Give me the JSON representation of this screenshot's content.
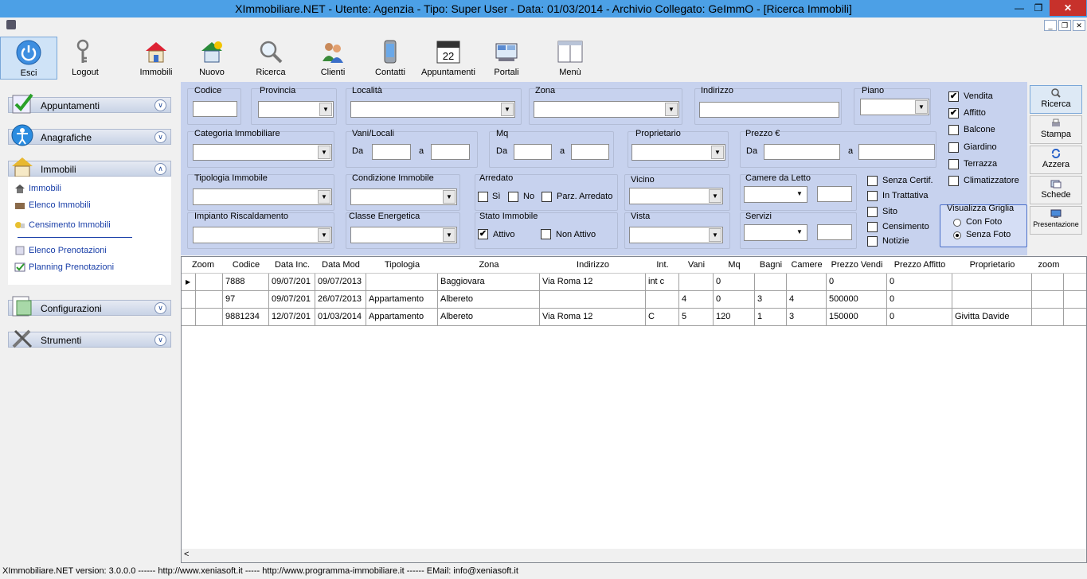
{
  "window": {
    "title": "XImmobiliare.NET - Utente: Agenzia - Tipo: Super User - Data: 01/03/2014 - Archivio Collegato: GeImmO - [Ricerca Immobili]",
    "minimize": "—",
    "restore": "❐",
    "close": "✕"
  },
  "mdi": {
    "minimize": "_",
    "restore": "❐",
    "close": "✕"
  },
  "toolbar": {
    "esci": "Esci",
    "logout": "Logout",
    "immobili": "Immobili",
    "nuovo": "Nuovo",
    "ricerca": "Ricerca",
    "clienti": "Clienti",
    "contatti": "Contatti",
    "appuntamenti": "Appuntamenti",
    "portali": "Portali",
    "menu": "Menù",
    "calendar_day": "22"
  },
  "sidebar": {
    "appuntamenti": "Appuntamenti",
    "anagrafiche": "Anagrafiche",
    "immobili": "Immobili",
    "configurazioni": "Configurazioni",
    "strumenti": "Strumenti",
    "sub": [
      "Immobili",
      "Elenco Immobili",
      "Censimento Immobili",
      "Elenco Prenotazioni",
      "Planning Prenotazioni"
    ]
  },
  "filters": {
    "codice": "Codice",
    "provincia": "Provincia",
    "localita": "Località",
    "zona": "Zona",
    "indirizzo": "Indirizzo",
    "piano": "Piano",
    "categoria": "Categoria Immobiliare",
    "vani": "Vani/Locali",
    "mq": "Mq",
    "proprietario": "Proprietario",
    "prezzo": "Prezzo €",
    "da": "Da",
    "a": "a",
    "tipologia": "Tipologia Immobile",
    "condizione": "Condizione Immobile",
    "arredato": "Arredato",
    "si": "Sì",
    "no": "No",
    "parz": "Parz. Arredato",
    "vicino": "Vicino",
    "camere": "Camere da Letto",
    "impianto": "Impianto Riscaldamento",
    "classe": "Classe Energetica",
    "stato": "Stato Immobile",
    "attivo": "Attivo",
    "non_attivo": "Non Attivo",
    "vista": "Vista",
    "servizi": "Servizi",
    "senza_certif": "Senza Certif.",
    "in_trattativa": "In Trattativa",
    "sito": "Sito",
    "censimento": "Censimento",
    "notizie": "Notizie",
    "vendita": "Vendita",
    "affitto": "Affitto",
    "balcone": "Balcone",
    "giardino": "Giardino",
    "terrazza": "Terrazza",
    "climatizzatore": "Climatizzatore",
    "visualizza": "Visualizza Griglia",
    "con_foto": "Con Foto",
    "senza_foto": "Senza Foto",
    "check": "✔",
    "arrow": "▼"
  },
  "actions": {
    "ricerca": "Ricerca",
    "stampa": "Stampa",
    "azzera": "Azzera",
    "schede": "Schede",
    "presentazione": "Presentazione"
  },
  "grid": {
    "columns": [
      "Zoom",
      "Codice",
      "Data Inc.",
      "Data Mod",
      "Tipologia",
      "Zona",
      "Indirizzo",
      "Int.",
      "Vani",
      "Mq",
      "Bagni",
      "Camere",
      "Prezzo Vendi",
      "Prezzo Affitto",
      "Proprietario",
      "zoom"
    ],
    "rows": [
      [
        "",
        "7888",
        "09/07/201",
        "09/07/2013",
        "",
        "Baggiovara",
        "Via Roma 12",
        "int c",
        "",
        "0",
        "",
        "",
        "0",
        "0",
        ""
      ],
      [
        "",
        "97",
        "09/07/201",
        "26/07/2013",
        "Appartamento",
        "Albereto",
        "",
        "",
        "4",
        "0",
        "3",
        "4",
        "500000",
        "0",
        ""
      ],
      [
        "",
        "9881234",
        "12/07/201",
        "01/03/2014",
        "Appartamento",
        "Albereto",
        "Via Roma 12",
        "C",
        "5",
        "120",
        "1",
        "3",
        "150000",
        "0",
        "Givitta Davide"
      ]
    ],
    "row_marker": "▶",
    "scroll_left": "<"
  },
  "status": "XImmobiliare.NET version: 3.0.0.0 ------ http://www.xeniasoft.it ----- http://www.programma-immobiliare.it ------ EMail: info@xeniasoft.it"
}
